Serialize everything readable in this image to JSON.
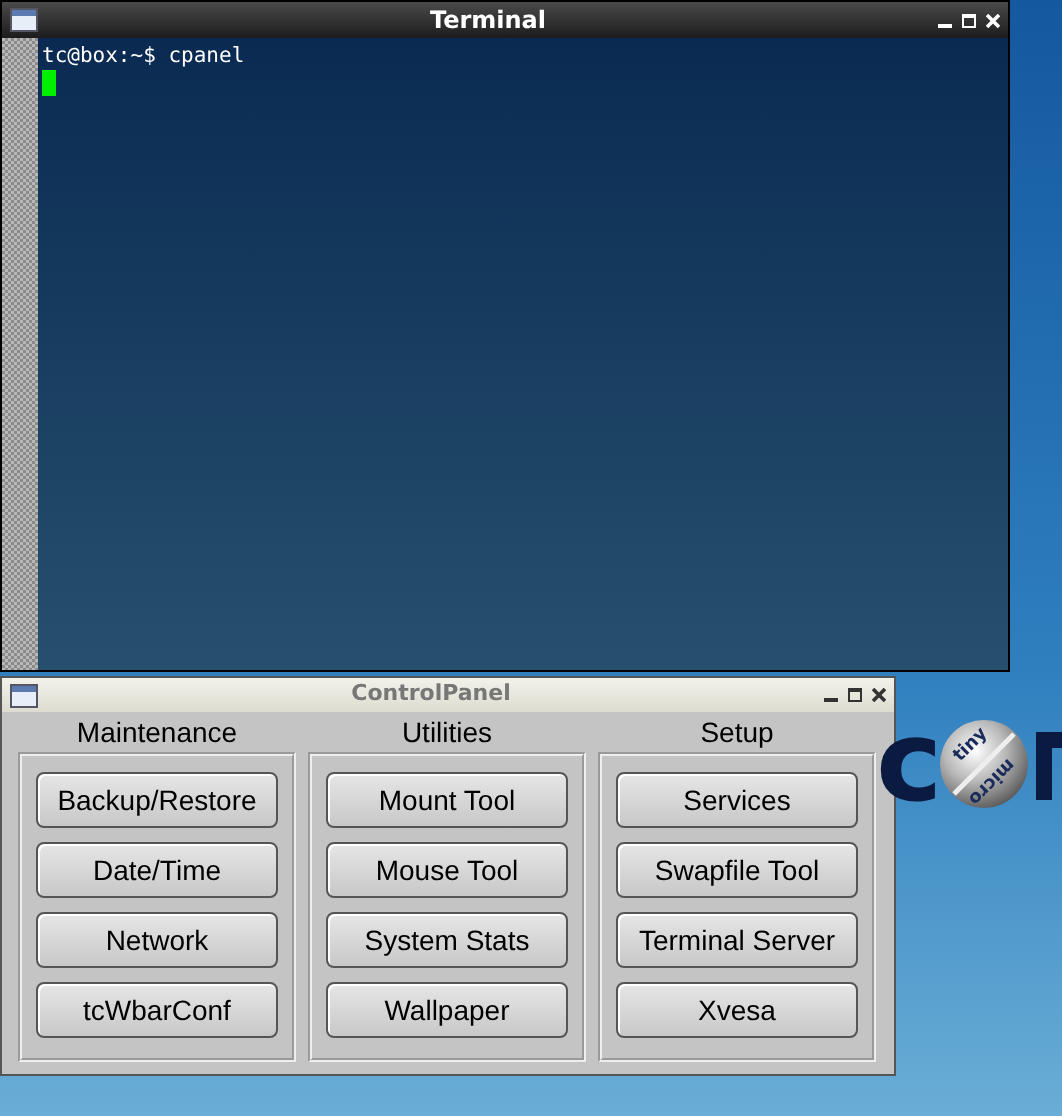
{
  "terminal": {
    "title": "Terminal",
    "lines": [
      "tc@box:~$ cpanel"
    ],
    "cursor": true
  },
  "control_panel": {
    "title": "ControlPanel",
    "columns": [
      {
        "heading": "Maintenance",
        "buttons": [
          "Backup/Restore",
          "Date/Time",
          "Network",
          "tcWbarConf"
        ]
      },
      {
        "heading": "Utilities",
        "buttons": [
          "Mount Tool",
          "Mouse Tool",
          "System Stats",
          "Wallpaper"
        ]
      },
      {
        "heading": "Setup",
        "buttons": [
          "Services",
          "Swapfile Tool",
          "Terminal Server",
          "Xvesa"
        ]
      }
    ]
  },
  "logo": {
    "left": "c",
    "top": "tiny",
    "bottom": "micro"
  }
}
